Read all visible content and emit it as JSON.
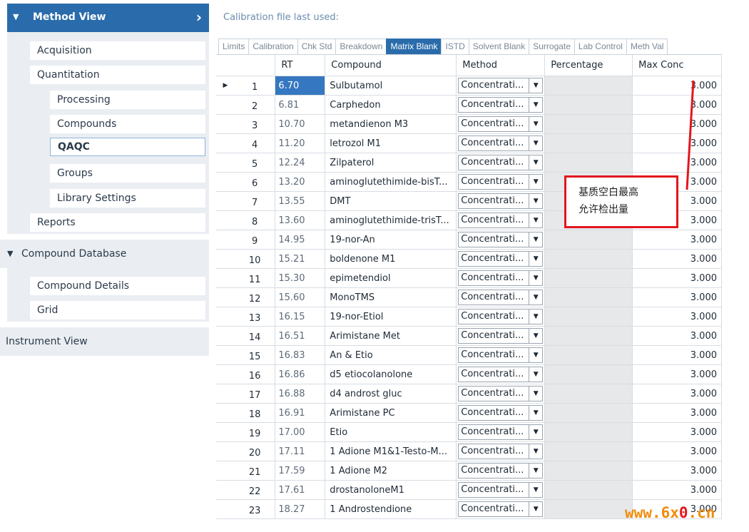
{
  "sidebar": {
    "header": {
      "title": "Method View"
    },
    "method_items": [
      {
        "label": "Acquisition"
      },
      {
        "label": "Quantitation"
      }
    ],
    "quant_children": [
      {
        "label": "Processing"
      },
      {
        "label": "Compounds"
      },
      {
        "label": "QAQC"
      },
      {
        "label": "Groups"
      },
      {
        "label": "Library Settings"
      }
    ],
    "reports": {
      "label": "Reports"
    },
    "compound_db": {
      "title": "Compound Database",
      "items": [
        {
          "label": "Compound Details"
        },
        {
          "label": "Grid"
        }
      ]
    },
    "instrument_view": {
      "title": "Instrument View"
    }
  },
  "main": {
    "calibration_label": "Calibration file last used:",
    "tabs": [
      "Limits",
      "Calibration",
      "Chk Std",
      "Breakdown",
      "Matrix Blank",
      "ISTD",
      "Solvent Blank",
      "Surrogate",
      "Lab Control",
      "Meth Val"
    ],
    "active_tab": "Matrix Blank",
    "columns": {
      "rt": "RT",
      "compound": "Compound",
      "method": "Method",
      "percentage": "Percentage",
      "max_conc": "Max Conc"
    },
    "rows": [
      {
        "num": "1",
        "rt": "6.70",
        "compound": "Sulbutamol",
        "method": "Concentrati...",
        "max": "3.000"
      },
      {
        "num": "2",
        "rt": "6.81",
        "compound": "Carphedon",
        "method": "Concentrati...",
        "max": "3.000"
      },
      {
        "num": "3",
        "rt": "10.70",
        "compound": "metandienon M3",
        "method": "Concentrati...",
        "max": "3.000"
      },
      {
        "num": "4",
        "rt": "11.20",
        "compound": "letrozol M1",
        "method": "Concentrati...",
        "max": "3.000"
      },
      {
        "num": "5",
        "rt": "12.24",
        "compound": "Zilpaterol",
        "method": "Concentrati...",
        "max": "3.000"
      },
      {
        "num": "6",
        "rt": "13.20",
        "compound": "aminoglutethimide-bisT...",
        "method": "Concentrati...",
        "max": "3.000"
      },
      {
        "num": "7",
        "rt": "13.55",
        "compound": "DMT",
        "method": "Concentrati...",
        "max": "3.000"
      },
      {
        "num": "8",
        "rt": "13.60",
        "compound": "aminoglutethimide-trisT...",
        "method": "Concentrati...",
        "max": "3.000"
      },
      {
        "num": "9",
        "rt": "14.95",
        "compound": "19-nor-An",
        "method": "Concentrati...",
        "max": "3.000"
      },
      {
        "num": "10",
        "rt": "15.21",
        "compound": "boldenone M1",
        "method": "Concentrati...",
        "max": "3.000"
      },
      {
        "num": "11",
        "rt": "15.30",
        "compound": "epimetendiol",
        "method": "Concentrati...",
        "max": "3.000"
      },
      {
        "num": "12",
        "rt": "15.60",
        "compound": "MonoTMS",
        "method": "Concentrati...",
        "max": "3.000"
      },
      {
        "num": "13",
        "rt": "16.15",
        "compound": "19-nor-Etiol",
        "method": "Concentrati...",
        "max": "3.000"
      },
      {
        "num": "14",
        "rt": "16.51",
        "compound": "Arimistane Met",
        "method": "Concentrati...",
        "max": "3.000"
      },
      {
        "num": "15",
        "rt": "16.83",
        "compound": "An & Etio",
        "method": "Concentrati...",
        "max": "3.000"
      },
      {
        "num": "16",
        "rt": "16.86",
        "compound": "d5 etiocolanolone",
        "method": "Concentrati...",
        "max": "3.000"
      },
      {
        "num": "17",
        "rt": "16.88",
        "compound": "d4 androst gluc",
        "method": "Concentrati...",
        "max": "3.000"
      },
      {
        "num": "18",
        "rt": "16.91",
        "compound": "Arimistane PC",
        "method": "Concentrati...",
        "max": "3.000"
      },
      {
        "num": "19",
        "rt": "17.00",
        "compound": "Etio",
        "method": "Concentrati...",
        "max": "3.000"
      },
      {
        "num": "20",
        "rt": "17.11",
        "compound": "1 Adione M1&1-Testo-M...",
        "method": "Concentrati...",
        "max": "3.000"
      },
      {
        "num": "21",
        "rt": "17.59",
        "compound": "1 Adione M2",
        "method": "Concentrati...",
        "max": "3.000"
      },
      {
        "num": "22",
        "rt": "17.61",
        "compound": "drostanoloneM1",
        "method": "Concentrati...",
        "max": "3.000"
      },
      {
        "num": "23",
        "rt": "18.27",
        "compound": "1 Androstendione",
        "method": "Concentrati...",
        "max": "3.000"
      }
    ]
  },
  "annotation": {
    "line1": "基质空白最高",
    "line2": "允许检出量",
    "color": "#e3161e"
  },
  "watermark": {
    "prefix": "www.6x",
    "o": "0",
    "suffix": ".cn"
  }
}
